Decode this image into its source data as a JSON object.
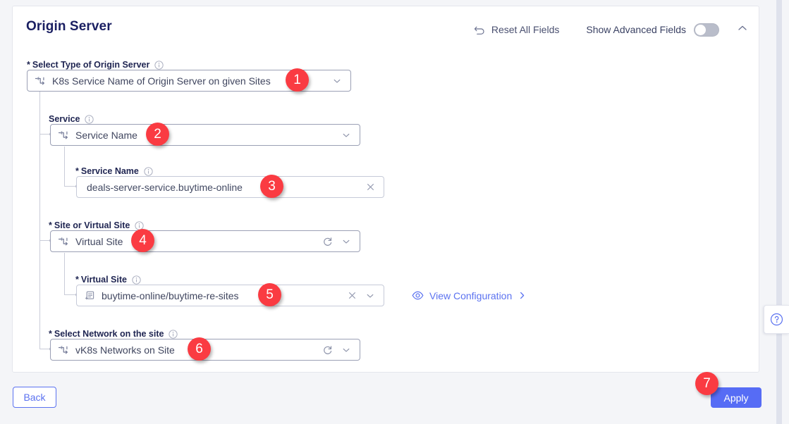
{
  "header": {
    "title": "Origin Server",
    "reset_label": "Reset All Fields",
    "advanced_label": "Show Advanced Fields",
    "advanced_toggle_state": "off",
    "collapse_icon": "chevron-up-icon",
    "reset_icon": "reset-arrow-icon"
  },
  "fields": {
    "origin_type": {
      "label": "Select Type of Origin Server",
      "required_marker": "*",
      "value": "K8s Service Name of Origin Server on given Sites",
      "lead_icon": "transform-arrows-icon",
      "info_icon": "info-icon",
      "chevron": "chevron-down-icon"
    },
    "service": {
      "label": "Service",
      "required_marker": "",
      "value": "Service Name",
      "lead_icon": "transform-arrows-icon",
      "info_icon": "info-icon",
      "chevron": "chevron-down-icon"
    },
    "service_name": {
      "label": "Service Name",
      "required_marker": "*",
      "value": "deals-server-service.buytime-online",
      "placeholder": "Service Name",
      "info_icon": "info-icon",
      "clear_icon": "close-icon"
    },
    "site_or_virtual_site": {
      "label": "Site or Virtual Site",
      "required_marker": "*",
      "value": "Virtual Site",
      "lead_icon": "transform-arrows-icon",
      "info_icon": "info-icon",
      "refresh_icon": "refresh-icon",
      "chevron": "chevron-down-icon"
    },
    "virtual_site": {
      "label": "Virtual Site",
      "required_marker": "*",
      "value": "buytime-online/buytime-re-sites",
      "lead_icon": "document-add-icon",
      "info_icon": "info-icon",
      "clear_icon": "close-icon",
      "chevron": "chevron-down-icon"
    },
    "network": {
      "label": "Select Network on the site",
      "required_marker": "*",
      "value": "vK8s Networks on Site",
      "lead_icon": "transform-arrows-icon",
      "info_icon": "info-icon",
      "refresh_icon": "refresh-icon",
      "chevron": "chevron-down-icon"
    }
  },
  "view_configuration": {
    "label": "View Configuration",
    "eye_icon": "eye-icon",
    "arrow_icon": "chevron-right-icon"
  },
  "footer": {
    "back_label": "Back",
    "apply_label": "Apply"
  },
  "help": {
    "icon": "question-circle-icon"
  },
  "annotations": [
    {
      "n": "1"
    },
    {
      "n": "2"
    },
    {
      "n": "3"
    },
    {
      "n": "4"
    },
    {
      "n": "5"
    },
    {
      "n": "6"
    },
    {
      "n": "7"
    }
  ],
  "colors": {
    "accent": "#566cf5",
    "badge": "#fa3b42",
    "title": "#1a1f62",
    "page_bg": "#f4f5f8"
  }
}
